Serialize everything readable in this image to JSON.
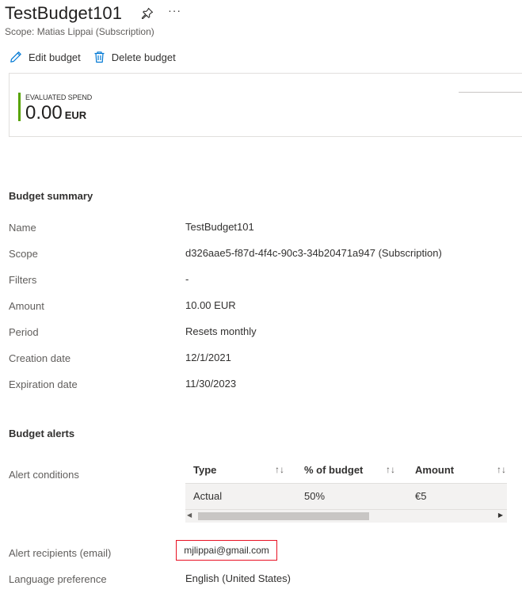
{
  "header": {
    "title": "TestBudget101",
    "subtitle": "Scope: Matias Lippai (Subscription)",
    "more_label": "···"
  },
  "toolbar": {
    "edit_label": "Edit budget",
    "delete_label": "Delete budget"
  },
  "spend": {
    "label": "EVALUATED SPEND",
    "value": "0.00",
    "unit": "EUR",
    "accent_color": "#57a300"
  },
  "summary": {
    "title": "Budget summary",
    "rows": [
      {
        "label": "Name",
        "value": "TestBudget101"
      },
      {
        "label": "Scope",
        "value": "d326aae5-f87d-4f4c-90c3-34b20471a947 (Subscription)"
      },
      {
        "label": "Filters",
        "value": "-"
      },
      {
        "label": "Amount",
        "value": "10.00 EUR"
      },
      {
        "label": "Period",
        "value": "Resets monthly"
      },
      {
        "label": "Creation date",
        "value": "12/1/2021"
      },
      {
        "label": "Expiration date",
        "value": "11/30/2023"
      }
    ]
  },
  "alerts": {
    "title": "Budget alerts",
    "conditions_label": "Alert conditions",
    "columns": [
      "Type",
      "% of budget",
      "Amount"
    ],
    "sort_glyph": "↑↓",
    "rows": [
      {
        "type": "Actual",
        "percent": "50%",
        "amount": "€5"
      }
    ],
    "recipients_label": "Alert recipients (email)",
    "recipients": [
      "mjlippai@gmail.com"
    ],
    "highlight_color": "#e81123",
    "language_label": "Language preference",
    "language_value": "English (United States)"
  },
  "icons": {
    "pin": "pin-icon",
    "edit": "pencil-icon",
    "delete": "trash-icon"
  }
}
